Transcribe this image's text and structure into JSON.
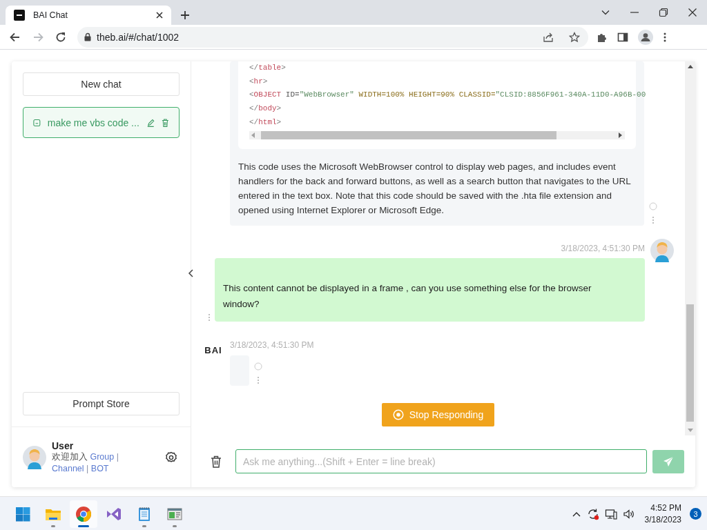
{
  "browser": {
    "tabs": [
      {
        "title": "BAI Chat",
        "selected": true
      }
    ],
    "nav": [
      {
        "kind": "back",
        "disabled": false
      },
      {
        "kind": "forward",
        "disabled": true
      },
      {
        "kind": "reload",
        "disabled": false
      }
    ],
    "url": "theb.ai/#/chat/1002"
  },
  "sidebar": {
    "new_chat": "New chat",
    "chats": [
      {
        "title": "make me vbs code ...",
        "selected": true
      }
    ],
    "prompt_store": "Prompt Store",
    "user": {
      "name": "User",
      "greeting": "欢迎加入",
      "links": [
        {
          "kind": "link",
          "text": "Group"
        },
        {
          "kind": "separator",
          "text": "|"
        },
        {
          "kind": "link",
          "text": "Channel"
        },
        {
          "kind": "separator",
          "text": "|"
        },
        {
          "kind": "link",
          "text": "BOT"
        }
      ]
    }
  },
  "conversation": {
    "messages": [
      {
        "kind": "bot",
        "code": [
          [
            {
              "kind": "punct",
              "text": "</"
            },
            {
              "kind": "tag",
              "text": "table"
            },
            {
              "kind": "punct",
              "text": ">"
            }
          ],
          [
            {
              "kind": "punct",
              "text": "<"
            },
            {
              "kind": "tag",
              "text": "hr"
            },
            {
              "kind": "punct",
              "text": ">"
            }
          ],
          [
            {
              "kind": "punct",
              "text": "<"
            },
            {
              "kind": "tag",
              "text": "OBJECT"
            },
            {
              "kind": "name",
              "text": " ID="
            },
            {
              "kind": "string",
              "text": "\"WebBrowser\""
            },
            {
              "kind": "attr",
              "text": " WIDTH=100% HEIGHT=90% CLASSID="
            },
            {
              "kind": "string",
              "text": "\"CLSID:8856F961-340A-11D0-A96B-00"
            }
          ],
          [
            {
              "kind": "punct",
              "text": "</"
            },
            {
              "kind": "tag",
              "text": "body"
            },
            {
              "kind": "punct",
              "text": ">"
            }
          ],
          [
            {
              "kind": "punct",
              "text": "</"
            },
            {
              "kind": "tag",
              "text": "html"
            },
            {
              "kind": "punct",
              "text": ">"
            }
          ]
        ],
        "text": "This code uses the Microsoft WebBrowser control to display web pages, and includes event handlers for the back and forward buttons, as well as a search button that navigates to the URL entered in the text box. Note that this code should be saved with the .hta file extension and opened using Internet Explorer or Microsoft Edge."
      },
      {
        "kind": "user",
        "time": "3/18/2023, 4:51:30 PM",
        "text": "This content cannot be displayed in a frame , can you use something else for the browser window?"
      },
      {
        "kind": "bot",
        "sender": "BAI",
        "time": "3/18/2023, 4:51:30 PM"
      }
    ],
    "stop_button": "Stop Responding",
    "input": {
      "placeholder": "Ask me anything...(Shift + Enter = line break)"
    }
  },
  "taskbar": {
    "apps": [
      {
        "kind": "start",
        "running": false,
        "selected": false
      },
      {
        "kind": "folder",
        "running": true,
        "selected": false
      },
      {
        "kind": "chrome",
        "running": true,
        "selected": true
      },
      {
        "kind": "studio",
        "running": false,
        "selected": false
      },
      {
        "kind": "notepad",
        "running": true,
        "selected": false
      },
      {
        "kind": "window",
        "running": true,
        "selected": false
      }
    ],
    "time": "4:52 PM",
    "date": "3/18/2023",
    "notification_count": "3"
  }
}
